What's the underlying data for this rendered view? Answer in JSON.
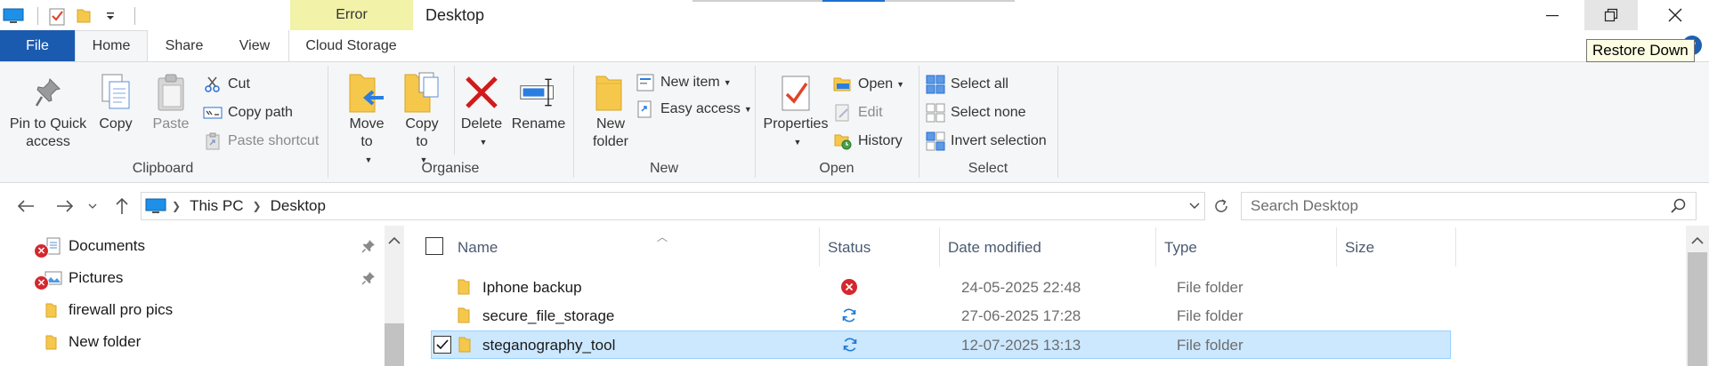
{
  "window": {
    "title": "Desktop",
    "context_tab_header": "Error",
    "tooltip": "Restore Down",
    "help": "?"
  },
  "tabs": [
    "File",
    "Home",
    "Share",
    "View",
    "Cloud Storage"
  ],
  "ribbon": {
    "clipboard": {
      "label": "Clipboard",
      "pin": "Pin to Quick access",
      "copy": "Copy",
      "paste": "Paste",
      "cut": "Cut",
      "copy_path": "Copy path",
      "paste_shortcut": "Paste shortcut"
    },
    "organise": {
      "label": "Organise",
      "move_to": "Move to",
      "copy_to": "Copy to",
      "delete": "Delete",
      "rename": "Rename"
    },
    "new": {
      "label": "New",
      "new_folder": "New folder",
      "new_item": "New item",
      "easy_access": "Easy access"
    },
    "open": {
      "label": "Open",
      "properties": "Properties",
      "open": "Open",
      "edit": "Edit",
      "history": "History"
    },
    "select": {
      "label": "Select",
      "select_all": "Select all",
      "select_none": "Select none",
      "invert": "Invert selection"
    }
  },
  "address": {
    "crumbs": [
      "This PC",
      "Desktop"
    ],
    "search_placeholder": "Search Desktop"
  },
  "nav_pane": [
    {
      "label": "Documents",
      "pinned": true,
      "error": true
    },
    {
      "label": "Pictures",
      "pinned": true,
      "error": true
    },
    {
      "label": "firewall pro pics",
      "pinned": false,
      "error": false
    },
    {
      "label": "New folder",
      "pinned": false,
      "error": false
    }
  ],
  "columns": {
    "name": "Name",
    "status": "Status",
    "date": "Date modified",
    "type": "Type",
    "size": "Size"
  },
  "files": [
    {
      "name": "Iphone backup",
      "status": "error",
      "date": "24-05-2025 22:48",
      "type": "File folder",
      "selected": false
    },
    {
      "name": "secure_file_storage",
      "status": "sync",
      "date": "27-06-2025 17:28",
      "type": "File folder",
      "selected": false
    },
    {
      "name": "steganography_tool",
      "status": "sync",
      "date": "12-07-2025 13:13",
      "type": "File folder",
      "selected": true
    }
  ],
  "colors": {
    "file_tab": "#1a5bb0",
    "context_tab": "#f2f2a8",
    "selection": "#cce8ff",
    "error": "#d4282e",
    "sync": "#1e7bd6",
    "folder": "#f5c84c"
  }
}
